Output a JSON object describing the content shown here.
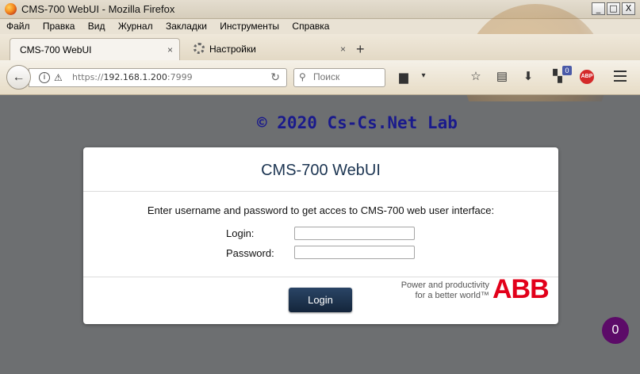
{
  "window": {
    "title": "CMS-700 WebUI - Mozilla Firefox",
    "controls": {
      "minimize": "_",
      "maximize": "□",
      "close": "X"
    }
  },
  "menu": [
    "Файл",
    "Правка",
    "Вид",
    "Журнал",
    "Закладки",
    "Инструменты",
    "Справка"
  ],
  "tabs": [
    {
      "label": "CMS-700 WebUI",
      "close": "×",
      "active": true
    },
    {
      "label": "Настройки",
      "close": "×",
      "active": false
    }
  ],
  "new_tab": "+",
  "urlbar": {
    "scheme": "https://",
    "host": "192.168.1.200",
    "port": ":7999"
  },
  "search": {
    "placeholder": "Поиск"
  },
  "extension_badge": "0",
  "abp_label": "ABP",
  "page": {
    "copyright": "© 2020 Cs-Cs.Net Lab",
    "card": {
      "title": "CMS-700 WebUI",
      "instruction": "Enter username and password to get acces to CMS-700 web user interface:",
      "login_label": "Login:",
      "password_label": "Password:",
      "login_value": "",
      "password_value": "",
      "button": "Login",
      "tagline_line1": "Power and productivity",
      "tagline_line2": "for a better world™",
      "logo": "ABB"
    },
    "counter": "0"
  },
  "colors": {
    "page_bg": "#6d6f71",
    "copyright": "#1a1a8c",
    "button_bg": "#1f3552",
    "abb_red": "#e2001a",
    "counter_bg": "#5c0b68"
  }
}
